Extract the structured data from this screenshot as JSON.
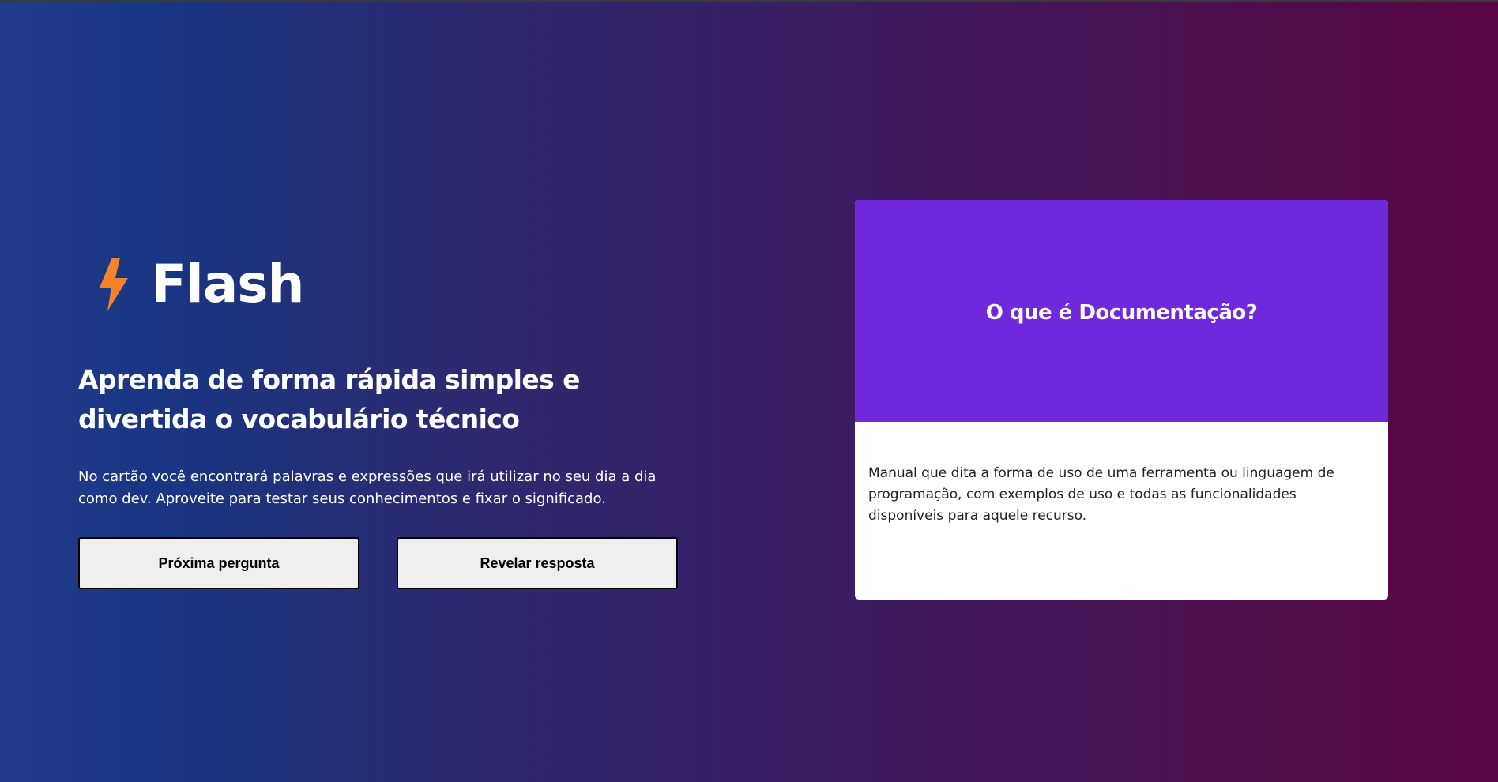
{
  "brand": {
    "name": "Flash",
    "icon": "lightning-bolt-icon",
    "icon_color": "#f5832a"
  },
  "hero": {
    "headline": "Aprenda de forma rápida simples e divertida o vocabulário técnico",
    "description": "No cartão você encontrará palavras e expressões que irá utilizar no seu dia a dia como dev. Aproveite para testar seus conhecimentos e fixar o significado."
  },
  "buttons": {
    "next_label": "Próxima pergunta",
    "reveal_label": "Revelar resposta"
  },
  "card": {
    "question": "O que é Documentação?",
    "answer": "Manual que dita a forma de uso de uma ferramenta ou linguagem de programação, com exemplos de uso e todas as funcionalidades disponíveis para aquele recurso.",
    "front_color": "#7028dc",
    "back_color": "#ffffff"
  },
  "theme": {
    "gradient_start": "#223c8a",
    "gradient_end": "#5a0643"
  }
}
